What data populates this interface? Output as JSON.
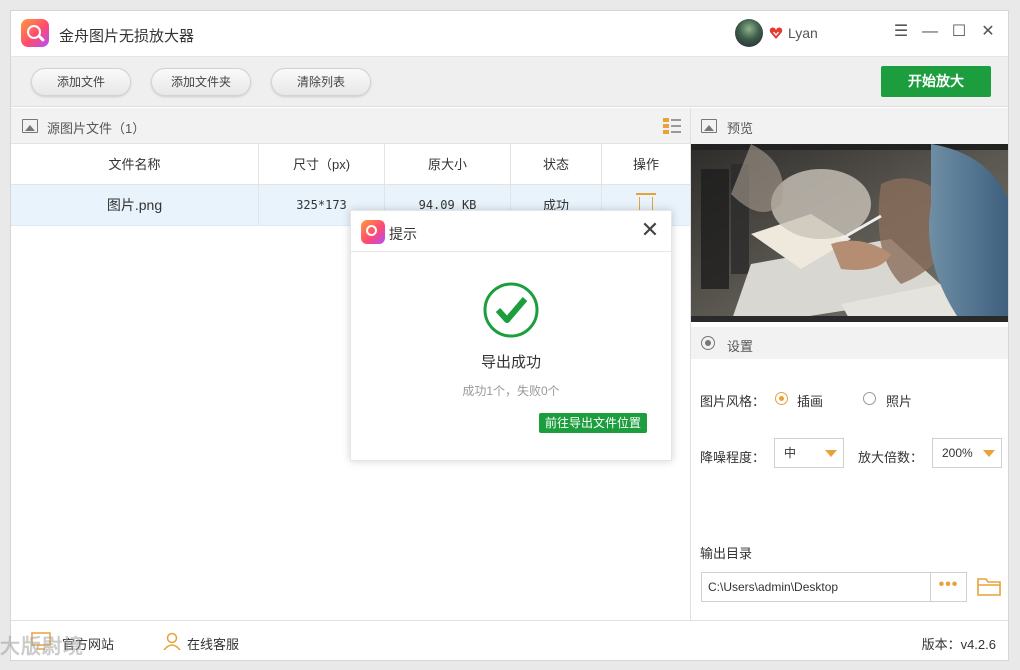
{
  "app": {
    "title": "金舟图片无损放大器",
    "username": "Lyan"
  },
  "window_controls": {
    "menu": "☰",
    "minimize": "—",
    "maximize": "☐",
    "close": "✕"
  },
  "toolbar": {
    "add_file": "添加文件",
    "add_folder": "添加文件夹",
    "clear_list": "清除列表",
    "start": "开始放大"
  },
  "source": {
    "title": "源图片文件（1）"
  },
  "table": {
    "headers": [
      "文件名称",
      "尺寸（px)",
      "原大小",
      "状态",
      "操作"
    ],
    "rows": [
      {
        "name": "图片.png",
        "size": "325*173",
        "filesize": "94.09 KB",
        "status": "成功"
      }
    ]
  },
  "preview": {
    "title": "预览"
  },
  "settings": {
    "title": "设置",
    "style_label": "图片风格：",
    "style_options": [
      "插画",
      "照片"
    ],
    "style_selected": "插画",
    "denoise_label": "降噪程度：",
    "denoise_value": "中",
    "scale_label": "放大倍数：",
    "scale_value": "200%",
    "output_label": "输出目录",
    "output_path": "C:\\Users\\admin\\Desktop",
    "more": "•••"
  },
  "footer": {
    "website": "官方网站",
    "support": "在线客服",
    "version": "版本：v4.2.6"
  },
  "watermark": "大版尉境",
  "dialog": {
    "title": "提示",
    "close": "✕",
    "message": "导出成功",
    "detail": "成功1个，失败0个",
    "link": "前往导出文件位置"
  },
  "colors": {
    "accent_green": "#1c9e3f",
    "accent_orange": "#e8a23a",
    "selected_row": "#e8f3fb"
  }
}
